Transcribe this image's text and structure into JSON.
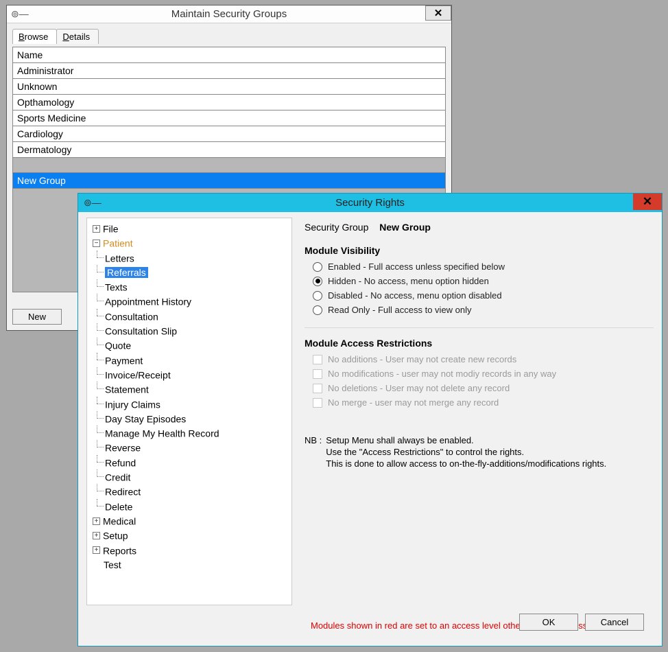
{
  "win1": {
    "title": "Maintain Security Groups",
    "tabs": {
      "browse": "Browse",
      "details": "Details"
    },
    "grid": {
      "header": "Name",
      "rows": [
        "Administrator",
        "Unknown",
        "Opthamology",
        "Sports Medicine",
        "Cardiology",
        "Dermatology"
      ],
      "selected": "New Group"
    },
    "buttons": {
      "new": "New"
    }
  },
  "win2": {
    "title": "Security Rights",
    "security_group_label": "Security Group",
    "security_group_value": "New Group",
    "module_visibility": {
      "title": "Module Visibility",
      "options": [
        "Enabled - Full access unless specified below",
        "Hidden - No access, menu option hidden",
        "Disabled - No access, menu option disabled",
        "Read Only - Full access to view only"
      ],
      "selected_index": 1
    },
    "module_access": {
      "title": "Module Access Restrictions",
      "options": [
        "No additions - User may not create new records",
        "No modifications - user may not modiy records in any way",
        "No deletions - User may not delete any record",
        "No merge - user may not merge any record"
      ]
    },
    "nb_label": "NB :",
    "nb_lines": [
      "Setup Menu shall always be enabled.",
      "Use the \"Access Restrictions\" to control the rights.",
      "This is done to allow access to on-the-fly-additions/modifications rights."
    ],
    "red_note": "Modules shown in red are set to an access level other than full access",
    "buttons": {
      "ok": "OK",
      "cancel": "Cancel"
    },
    "tree": {
      "file": "File",
      "patient": "Patient",
      "patient_children": [
        "Letters",
        "Referrals",
        "Texts",
        "Appointment History",
        "Consultation",
        "Consultation Slip",
        "Quote",
        "Payment",
        "Invoice/Receipt",
        "Statement",
        "Injury Claims",
        "Day Stay Episodes",
        "Manage My Health Record",
        "Reverse",
        "Refund",
        "Credit",
        "Redirect",
        "Delete"
      ],
      "selected_patient_child_index": 1,
      "medical": "Medical",
      "setup": "Setup",
      "reports": "Reports",
      "test": "Test"
    }
  }
}
